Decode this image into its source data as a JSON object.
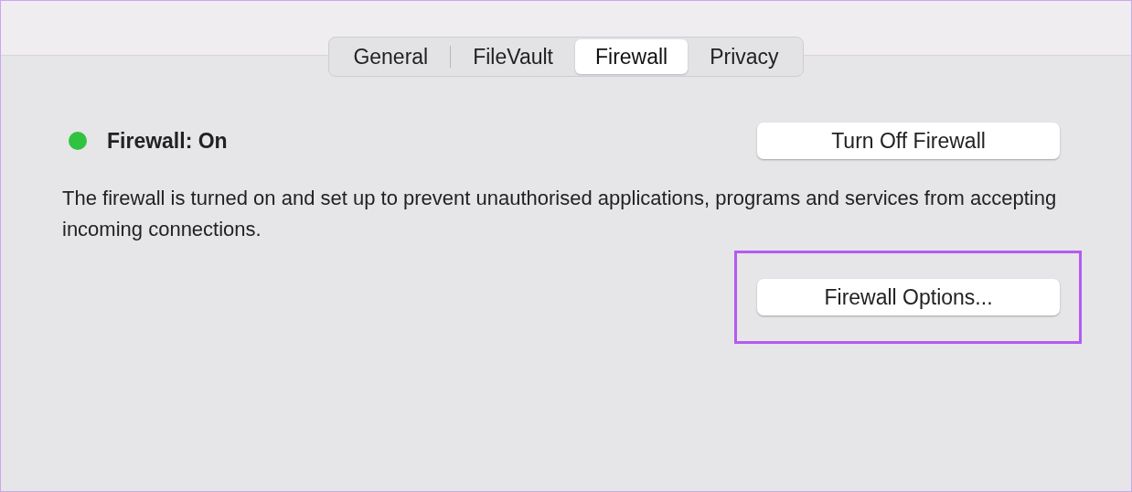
{
  "tabs": [
    {
      "label": "General",
      "selected": false
    },
    {
      "label": "FileVault",
      "selected": false
    },
    {
      "label": "Firewall",
      "selected": true
    },
    {
      "label": "Privacy",
      "selected": false
    }
  ],
  "status": {
    "label": "Firewall: On",
    "color": "#30c241"
  },
  "toggle_button": "Turn Off Firewall",
  "description": "The firewall is turned on and set up to prevent unauthorised applications, programs and services from accepting incoming connections.",
  "options_button": {
    "label": "Firewall Options...",
    "highlighted": true
  }
}
